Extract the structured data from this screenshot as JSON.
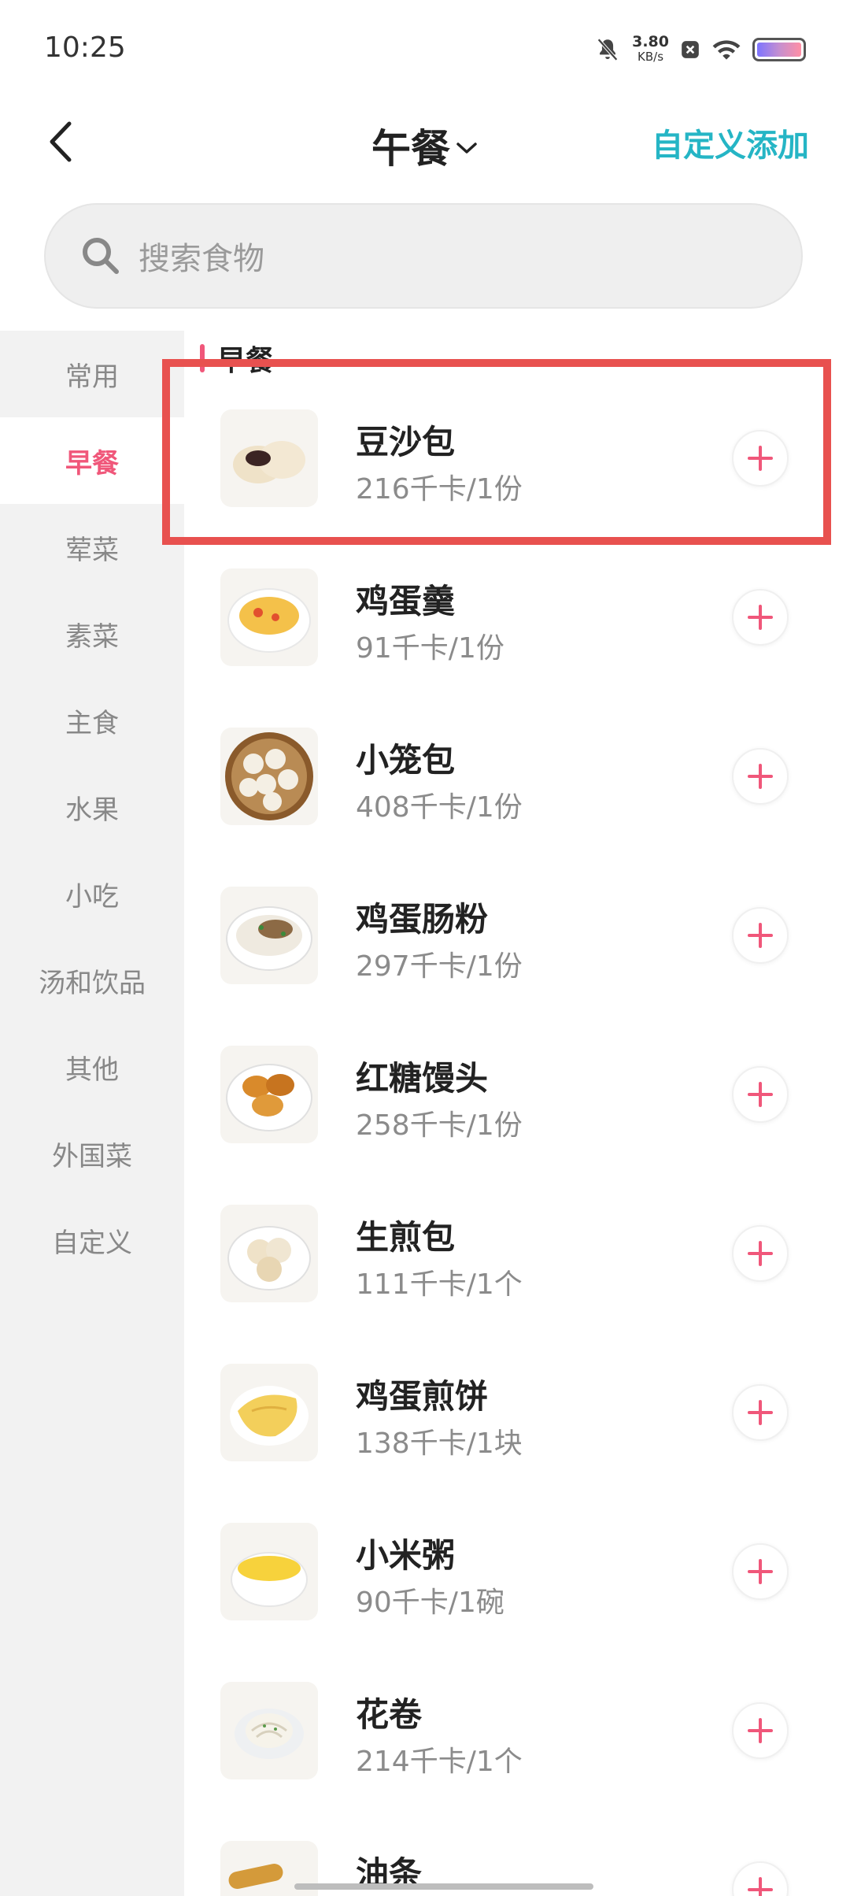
{
  "status_bar": {
    "time": "10:25",
    "net_speed_value": "3.80",
    "net_speed_unit": "KB/s",
    "icons": [
      "silent-bell-icon",
      "network-speed",
      "x-badge-icon",
      "wifi-icon",
      "battery-icon"
    ]
  },
  "header": {
    "title": "午餐",
    "title_chevron": "chevron-down-icon",
    "back_icon": "chevron-left-icon",
    "right_action": "自定义添加"
  },
  "search": {
    "placeholder": "搜索食物",
    "icon": "search-icon"
  },
  "sidebar": {
    "items": [
      {
        "label": "常用",
        "active": false
      },
      {
        "label": "早餐",
        "active": true
      },
      {
        "label": "荤菜",
        "active": false
      },
      {
        "label": "素菜",
        "active": false
      },
      {
        "label": "主食",
        "active": false
      },
      {
        "label": "水果",
        "active": false
      },
      {
        "label": "小吃",
        "active": false
      },
      {
        "label": "汤和饮品",
        "active": false
      },
      {
        "label": "其他",
        "active": false
      },
      {
        "label": "外国菜",
        "active": false
      },
      {
        "label": "自定义",
        "active": false
      }
    ]
  },
  "section": {
    "title": "早餐"
  },
  "foods": [
    {
      "name": "豆沙包",
      "calories": "216千卡/1份",
      "image": "steamed-bun-icon"
    },
    {
      "name": "鸡蛋羹",
      "calories": "91千卡/1份",
      "image": "egg-custard-icon"
    },
    {
      "name": "小笼包",
      "calories": "408千卡/1份",
      "image": "xiaolongbao-icon"
    },
    {
      "name": "鸡蛋肠粉",
      "calories": "297千卡/1份",
      "image": "rice-roll-icon"
    },
    {
      "name": "红糖馒头",
      "calories": "258千卡/1份",
      "image": "brown-sugar-bun-icon"
    },
    {
      "name": "生煎包",
      "calories": "111千卡/1个",
      "image": "pan-fried-bun-icon"
    },
    {
      "name": "鸡蛋煎饼",
      "calories": "138千卡/1块",
      "image": "egg-pancake-icon"
    },
    {
      "name": "小米粥",
      "calories": "90千卡/1碗",
      "image": "millet-porridge-icon"
    },
    {
      "name": "花卷",
      "calories": "214千卡/1个",
      "image": "flower-roll-icon"
    },
    {
      "name": "油条",
      "calories": "",
      "image": "youtiao-icon"
    }
  ],
  "colors": {
    "accent_pink": "#f0577a",
    "custom_add_teal": "#25b5c5",
    "highlight_red": "#e8514f"
  }
}
